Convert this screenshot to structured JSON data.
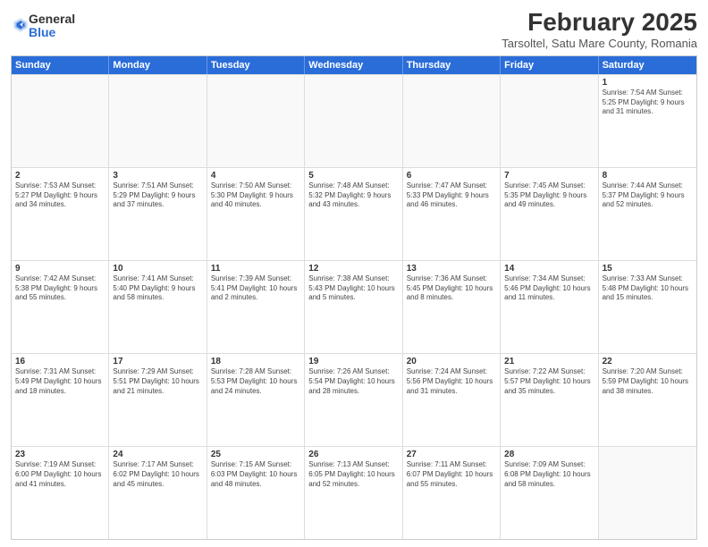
{
  "logo": {
    "general": "General",
    "blue": "Blue"
  },
  "title": "February 2025",
  "location": "Tarsoltel, Satu Mare County, Romania",
  "header_days": [
    "Sunday",
    "Monday",
    "Tuesday",
    "Wednesday",
    "Thursday",
    "Friday",
    "Saturday"
  ],
  "weeks": [
    [
      {
        "day": "",
        "info": ""
      },
      {
        "day": "",
        "info": ""
      },
      {
        "day": "",
        "info": ""
      },
      {
        "day": "",
        "info": ""
      },
      {
        "day": "",
        "info": ""
      },
      {
        "day": "",
        "info": ""
      },
      {
        "day": "1",
        "info": "Sunrise: 7:54 AM\nSunset: 5:25 PM\nDaylight: 9 hours and 31 minutes."
      }
    ],
    [
      {
        "day": "2",
        "info": "Sunrise: 7:53 AM\nSunset: 5:27 PM\nDaylight: 9 hours and 34 minutes."
      },
      {
        "day": "3",
        "info": "Sunrise: 7:51 AM\nSunset: 5:29 PM\nDaylight: 9 hours and 37 minutes."
      },
      {
        "day": "4",
        "info": "Sunrise: 7:50 AM\nSunset: 5:30 PM\nDaylight: 9 hours and 40 minutes."
      },
      {
        "day": "5",
        "info": "Sunrise: 7:48 AM\nSunset: 5:32 PM\nDaylight: 9 hours and 43 minutes."
      },
      {
        "day": "6",
        "info": "Sunrise: 7:47 AM\nSunset: 5:33 PM\nDaylight: 9 hours and 46 minutes."
      },
      {
        "day": "7",
        "info": "Sunrise: 7:45 AM\nSunset: 5:35 PM\nDaylight: 9 hours and 49 minutes."
      },
      {
        "day": "8",
        "info": "Sunrise: 7:44 AM\nSunset: 5:37 PM\nDaylight: 9 hours and 52 minutes."
      }
    ],
    [
      {
        "day": "9",
        "info": "Sunrise: 7:42 AM\nSunset: 5:38 PM\nDaylight: 9 hours and 55 minutes."
      },
      {
        "day": "10",
        "info": "Sunrise: 7:41 AM\nSunset: 5:40 PM\nDaylight: 9 hours and 58 minutes."
      },
      {
        "day": "11",
        "info": "Sunrise: 7:39 AM\nSunset: 5:41 PM\nDaylight: 10 hours and 2 minutes."
      },
      {
        "day": "12",
        "info": "Sunrise: 7:38 AM\nSunset: 5:43 PM\nDaylight: 10 hours and 5 minutes."
      },
      {
        "day": "13",
        "info": "Sunrise: 7:36 AM\nSunset: 5:45 PM\nDaylight: 10 hours and 8 minutes."
      },
      {
        "day": "14",
        "info": "Sunrise: 7:34 AM\nSunset: 5:46 PM\nDaylight: 10 hours and 11 minutes."
      },
      {
        "day": "15",
        "info": "Sunrise: 7:33 AM\nSunset: 5:48 PM\nDaylight: 10 hours and 15 minutes."
      }
    ],
    [
      {
        "day": "16",
        "info": "Sunrise: 7:31 AM\nSunset: 5:49 PM\nDaylight: 10 hours and 18 minutes."
      },
      {
        "day": "17",
        "info": "Sunrise: 7:29 AM\nSunset: 5:51 PM\nDaylight: 10 hours and 21 minutes."
      },
      {
        "day": "18",
        "info": "Sunrise: 7:28 AM\nSunset: 5:53 PM\nDaylight: 10 hours and 24 minutes."
      },
      {
        "day": "19",
        "info": "Sunrise: 7:26 AM\nSunset: 5:54 PM\nDaylight: 10 hours and 28 minutes."
      },
      {
        "day": "20",
        "info": "Sunrise: 7:24 AM\nSunset: 5:56 PM\nDaylight: 10 hours and 31 minutes."
      },
      {
        "day": "21",
        "info": "Sunrise: 7:22 AM\nSunset: 5:57 PM\nDaylight: 10 hours and 35 minutes."
      },
      {
        "day": "22",
        "info": "Sunrise: 7:20 AM\nSunset: 5:59 PM\nDaylight: 10 hours and 38 minutes."
      }
    ],
    [
      {
        "day": "23",
        "info": "Sunrise: 7:19 AM\nSunset: 6:00 PM\nDaylight: 10 hours and 41 minutes."
      },
      {
        "day": "24",
        "info": "Sunrise: 7:17 AM\nSunset: 6:02 PM\nDaylight: 10 hours and 45 minutes."
      },
      {
        "day": "25",
        "info": "Sunrise: 7:15 AM\nSunset: 6:03 PM\nDaylight: 10 hours and 48 minutes."
      },
      {
        "day": "26",
        "info": "Sunrise: 7:13 AM\nSunset: 6:05 PM\nDaylight: 10 hours and 52 minutes."
      },
      {
        "day": "27",
        "info": "Sunrise: 7:11 AM\nSunset: 6:07 PM\nDaylight: 10 hours and 55 minutes."
      },
      {
        "day": "28",
        "info": "Sunrise: 7:09 AM\nSunset: 6:08 PM\nDaylight: 10 hours and 58 minutes."
      },
      {
        "day": "",
        "info": ""
      }
    ]
  ]
}
